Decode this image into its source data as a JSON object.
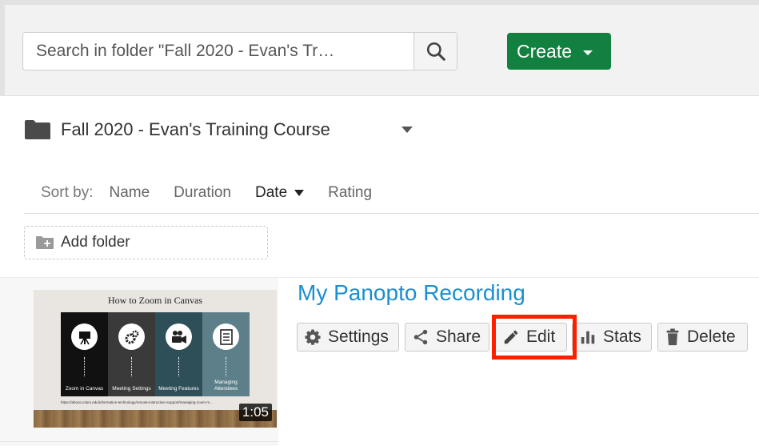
{
  "search": {
    "placeholder": "Search in folder \"Fall 2020 - Evan's Tr…"
  },
  "toolbar": {
    "create_label": "Create"
  },
  "folder": {
    "title": "Fall 2020 - Evan's Training Course"
  },
  "sort": {
    "label": "Sort by:",
    "options": [
      "Name",
      "Duration",
      "Date",
      "Rating"
    ],
    "active": "Date"
  },
  "add_folder_label": "Add folder",
  "recording": {
    "title": "My Panopto Recording",
    "duration": "1:05",
    "thumbnail": {
      "title": "How to Zoom in Canvas",
      "panels": [
        "Zoom in Canvas",
        "Meeting Settings",
        "Meeting Features",
        "Managing Attendees"
      ],
      "url": "https://about.colum.edu/information-technology/remote-instruction-support/managing-zoom-m..."
    },
    "actions": {
      "settings": "Settings",
      "share": "Share",
      "edit": "Edit",
      "stats": "Stats",
      "delete": "Delete"
    }
  },
  "colors": {
    "create_green": "#128140",
    "title_blue": "#1a8fd0",
    "highlight_red": "#ff1f00"
  },
  "icons": [
    "search-icon",
    "folder-icon",
    "add-folder-icon",
    "gear-icon",
    "share-icon",
    "pencil-icon",
    "bar-chart-icon",
    "trash-icon"
  ]
}
